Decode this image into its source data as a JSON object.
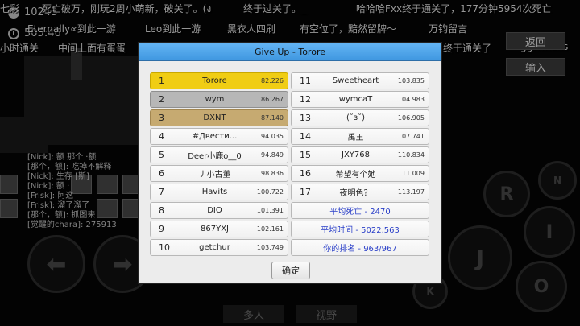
{
  "hud": {
    "deaths": "10243",
    "time": "505:46"
  },
  "danmaku": [
    "七彩",
    "死亡破万，刚玩2周小萌新，破关了。(ง",
    "终于过关了。_",
    "哈哈哈Fxx终于通关了，177分钟5954次死亡",
    "Eternally∝到此一游",
    "Leo到此一游",
    "黑衣人四刷",
    "有空位了，黯然留牌～",
    "万钧留言",
    "小时通关",
    "中间上面有蛋蛋",
    "终于通关了",
    "gg!!wlans"
  ],
  "chat": [
    "[Nick]: 额  那个 ·额",
    "[那个，额]: 吃掉不解释",
    "[Nick]: 生存 [斯]",
    "[Nick]: 额 ·",
    "[Frisk]: 阿这",
    "[Frisk]: 溜了溜了",
    "[那个，额]: 抓图来",
    "[觉醒的chara]: 275913"
  ],
  "side_buttons": {
    "back": "返回",
    "input": "输入"
  },
  "touch_controls": {
    "r": "R",
    "i": "I",
    "j": "J",
    "o": "O",
    "n": "N",
    "k": "K",
    "left": "⬅",
    "right": "➡"
  },
  "bottom_tabs": {
    "multiplayer": "多人",
    "view": "视野"
  },
  "dialog": {
    "title": "Give Up - Torore",
    "confirm": "确定",
    "left_column": [
      {
        "rank": "1",
        "name": "Torore",
        "time": "82.226",
        "style": "gold"
      },
      {
        "rank": "2",
        "name": "wym",
        "time": "86.267",
        "style": "silver"
      },
      {
        "rank": "3",
        "name": "DXNT",
        "time": "87.140",
        "style": "bronze"
      },
      {
        "rank": "4",
        "name": "#Двести...",
        "time": "94.035",
        "style": ""
      },
      {
        "rank": "5",
        "name": "Deer小鹿o__0",
        "time": "94.849",
        "style": ""
      },
      {
        "rank": "6",
        "name": "丿小古董",
        "time": "98.836",
        "style": ""
      },
      {
        "rank": "7",
        "name": "Havits",
        "time": "100.722",
        "style": ""
      },
      {
        "rank": "8",
        "name": "DIO",
        "time": "101.391",
        "style": ""
      },
      {
        "rank": "9",
        "name": "867YXJ",
        "time": "102.161",
        "style": ""
      },
      {
        "rank": "10",
        "name": "getchur",
        "time": "103.749",
        "style": ""
      }
    ],
    "right_column": [
      {
        "rank": "11",
        "name": "Sweetheart",
        "time": "103.835"
      },
      {
        "rank": "12",
        "name": "wymcaT",
        "time": "104.983"
      },
      {
        "rank": "13",
        "name": "(˘з˘)",
        "time": "106.905"
      },
      {
        "rank": "14",
        "name": "禹王",
        "time": "107.741"
      },
      {
        "rank": "15",
        "name": "JXY768",
        "time": "110.834"
      },
      {
        "rank": "16",
        "name": "希望有个她",
        "time": "111.009"
      },
      {
        "rank": "17",
        "name": "夜明色？",
        "time": "113.197"
      }
    ],
    "stats": {
      "avg_deaths": "平均死亡 - 2470",
      "avg_time": "平均时间 - 5022.563",
      "your_rank": "你的排名 - 963/967"
    }
  }
}
